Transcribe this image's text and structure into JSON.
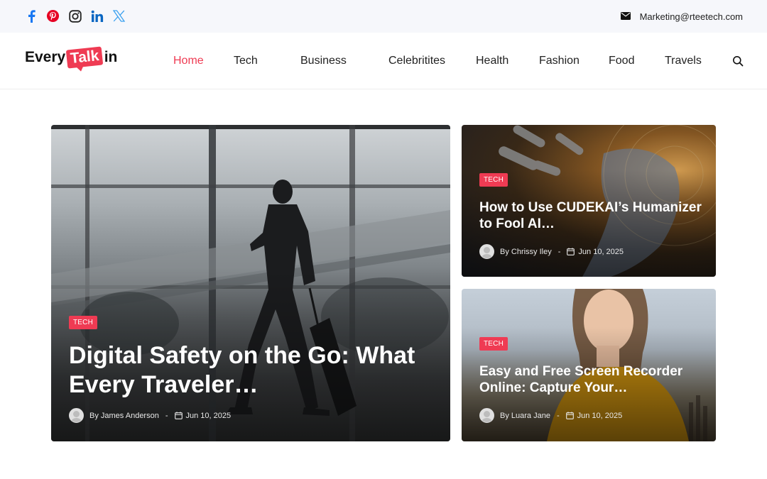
{
  "topbar": {
    "social": [
      {
        "icon": "facebook-icon",
        "color": "#1877f2"
      },
      {
        "icon": "pinterest-icon",
        "color": "#e60023"
      },
      {
        "icon": "instagram-icon",
        "color": "#222222"
      },
      {
        "icon": "linkedin-icon",
        "color": "#0a66c2"
      },
      {
        "icon": "x-twitter-icon",
        "color": "#3ea2ef"
      }
    ],
    "email": "Marketing@rteetech.com"
  },
  "header": {
    "logo": {
      "part1": "Every",
      "part2": "Talk",
      "part3": "in"
    },
    "nav": [
      {
        "label": "Home",
        "active": true
      },
      {
        "label": "Tech",
        "active": false
      },
      {
        "label": "Business",
        "active": false
      },
      {
        "label": "Celebritites",
        "active": false
      },
      {
        "label": "Health",
        "active": false
      },
      {
        "label": "Fashion",
        "active": false
      },
      {
        "label": "Food",
        "active": false
      },
      {
        "label": "Travels",
        "active": false
      }
    ],
    "search_icon": "search-icon"
  },
  "colors": {
    "accent": "#ef3b53"
  },
  "articles": [
    {
      "tag": "TECH",
      "title": "Digital Safety on the Go: What Every Traveler…",
      "author": "By James Anderson",
      "date": "Jun 10, 2025"
    },
    {
      "tag": "TECH",
      "title": "How to Use CUDEKAI’s Humanizer to Fool AI…",
      "author": "By Chrissy Iley",
      "date": "Jun 10, 2025"
    },
    {
      "tag": "TECH",
      "title": "Easy and Free Screen Recorder Online: Capture Your…",
      "author": "By Luara Jane",
      "date": "Jun 10, 2025"
    }
  ]
}
